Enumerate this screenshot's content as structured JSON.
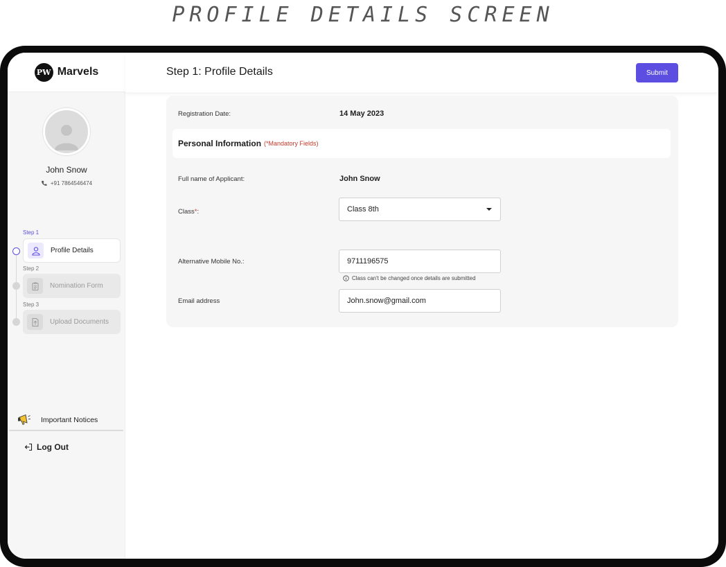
{
  "caption": "PROFILE DETAILS SCREEN",
  "brand": {
    "logo_text": "PW",
    "name": "Marvels"
  },
  "user": {
    "name": "John Snow",
    "phone": "+91 7864546474"
  },
  "steps": [
    {
      "step_label": "Step 1",
      "label": "Profile Details",
      "icon": "user-icon",
      "active": true
    },
    {
      "step_label": "Step 2",
      "label": "Nomination Form",
      "icon": "clipboard-icon",
      "active": false
    },
    {
      "step_label": "Step 3",
      "label": "Upload Documents",
      "icon": "upload-icon",
      "active": false
    }
  ],
  "sidebar": {
    "notices_label": "Important Notices",
    "logout_label": "Log Out"
  },
  "header": {
    "title": "Step 1: Profile Details",
    "submit_label": "Submit"
  },
  "form": {
    "registration_label": "Registration Date:",
    "registration_value": "14 May 2023",
    "section_title": "Personal Information",
    "section_note": "(*Mandatory Fields)",
    "fullname_label": "Full name of Applicant:",
    "fullname_value": "John Snow",
    "class_label": "Class",
    "class_required": "*",
    "class_colon": ":",
    "class_value": "Class 8th",
    "class_hint": "Class can't be changed once details are submitted",
    "mobile_label": "Alternative Mobile No.:",
    "mobile_value": "9711196575",
    "email_label": "Email address",
    "email_value": "John.snow@gmail.com"
  },
  "colors": {
    "accent": "#5b4ee0",
    "mandatory": "#c0392b",
    "sidebar_bg": "#f6f6f6"
  }
}
